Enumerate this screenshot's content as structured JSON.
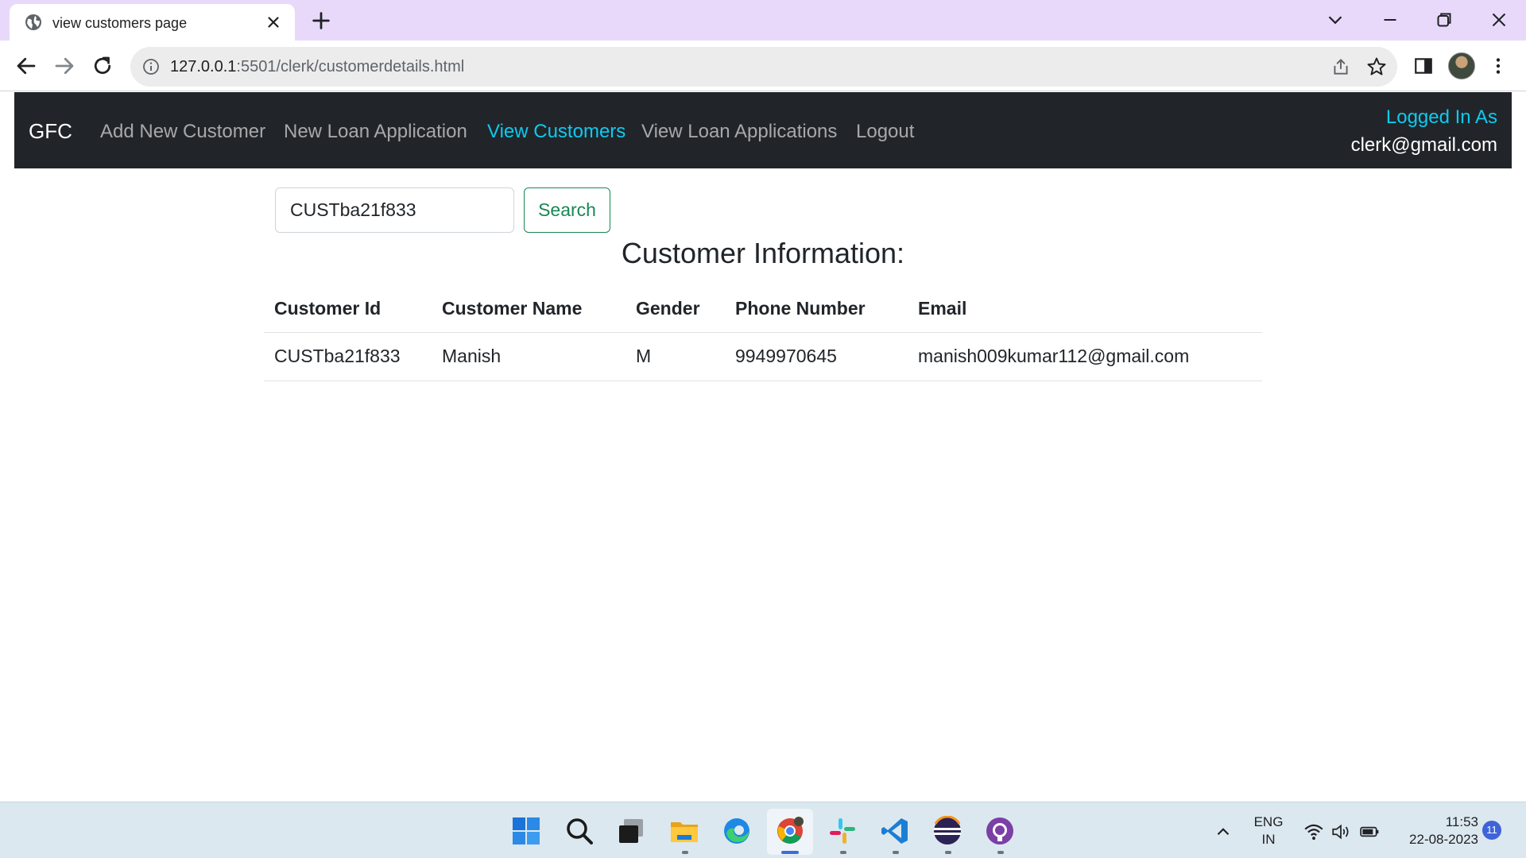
{
  "browser": {
    "tab_title": "view customers page",
    "url_host": "127.0.0.1",
    "url_path": ":5501/clerk/customerdetails.html"
  },
  "navbar": {
    "brand": "GFC",
    "links": [
      {
        "label": "Add New Customer",
        "active": false
      },
      {
        "label": "New Loan Application",
        "active": false
      },
      {
        "label": "View Customers",
        "active": true
      },
      {
        "label": "View Loan Applications",
        "active": false
      },
      {
        "label": "Logout",
        "active": false
      }
    ],
    "logged_in_label": "Logged In As",
    "logged_in_user": "clerk@gmail.com"
  },
  "search": {
    "value": "CUSTba21f833",
    "button_label": "Search"
  },
  "section_title": "Customer Information:",
  "table": {
    "headers": [
      "Customer Id",
      "Customer Name",
      "Gender",
      "Phone Number",
      "Email"
    ],
    "rows": [
      [
        "CUSTba21f833",
        "Manish",
        "M",
        "9949970645",
        "manish009kumar112@gmail.com"
      ]
    ]
  },
  "taskbar": {
    "apps": [
      "windows-start",
      "search",
      "task-view",
      "file-explorer",
      "edge",
      "chrome",
      "slack",
      "vscode",
      "eclipse",
      "github-desktop"
    ],
    "language_line1": "ENG",
    "language_line2": "IN",
    "time": "11:53",
    "date": "22-08-2023",
    "notification_count": "11"
  },
  "colors": {
    "tabstrip": "#e8d9fb",
    "navbar": "#212529",
    "active_link": "#0dcaf0",
    "search_button": "#198754",
    "taskbar": "#dce8ef"
  }
}
